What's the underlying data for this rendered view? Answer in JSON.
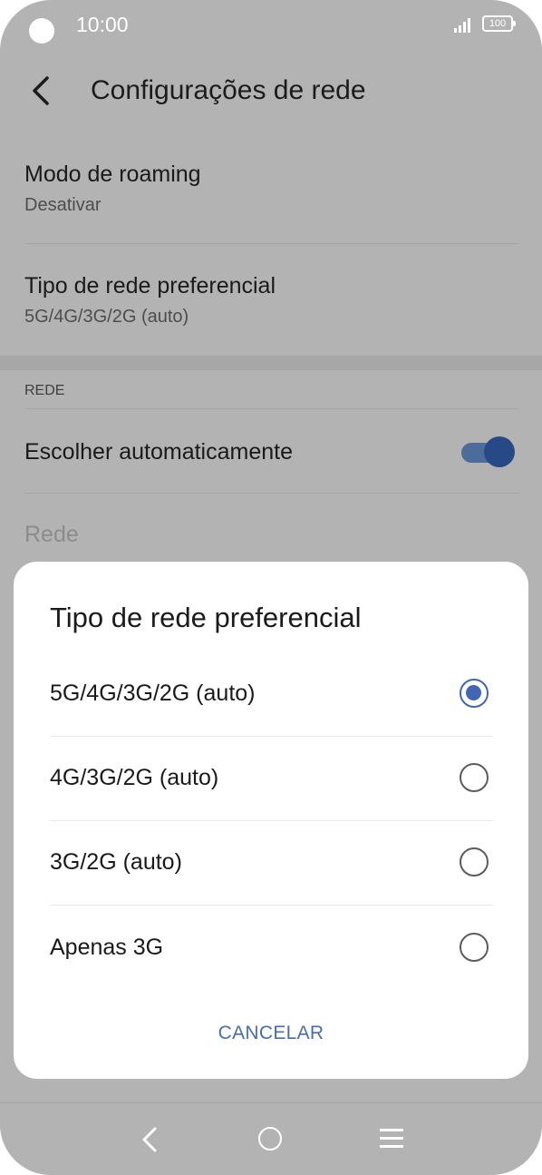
{
  "status_bar": {
    "time": "10:00",
    "battery": "100"
  },
  "app_bar": {
    "title": "Configurações de rede"
  },
  "settings": {
    "roaming": {
      "label": "Modo de roaming",
      "value": "Desativar"
    },
    "network_type": {
      "label": "Tipo de rede preferencial",
      "value": "5G/4G/3G/2G (auto)"
    },
    "section_title": "REDE",
    "auto_select": {
      "label": "Escolher automaticamente",
      "enabled": true
    },
    "network": {
      "label": "Rede"
    }
  },
  "dialog": {
    "title": "Tipo de rede preferencial",
    "options": [
      {
        "label": "5G/4G/3G/2G (auto)",
        "selected": true
      },
      {
        "label": "4G/3G/2G (auto)",
        "selected": false
      },
      {
        "label": "3G/2G (auto)",
        "selected": false
      },
      {
        "label": "Apenas 3G",
        "selected": false
      }
    ],
    "cancel_label": "CANCELAR"
  },
  "nav_bar": {
    "icons": [
      "back-icon",
      "home-icon",
      "recents-menu-icon"
    ]
  },
  "colors": {
    "accent": "#4167b1",
    "scrim": "#b3b3b3",
    "toggle_on": "#274a87"
  }
}
